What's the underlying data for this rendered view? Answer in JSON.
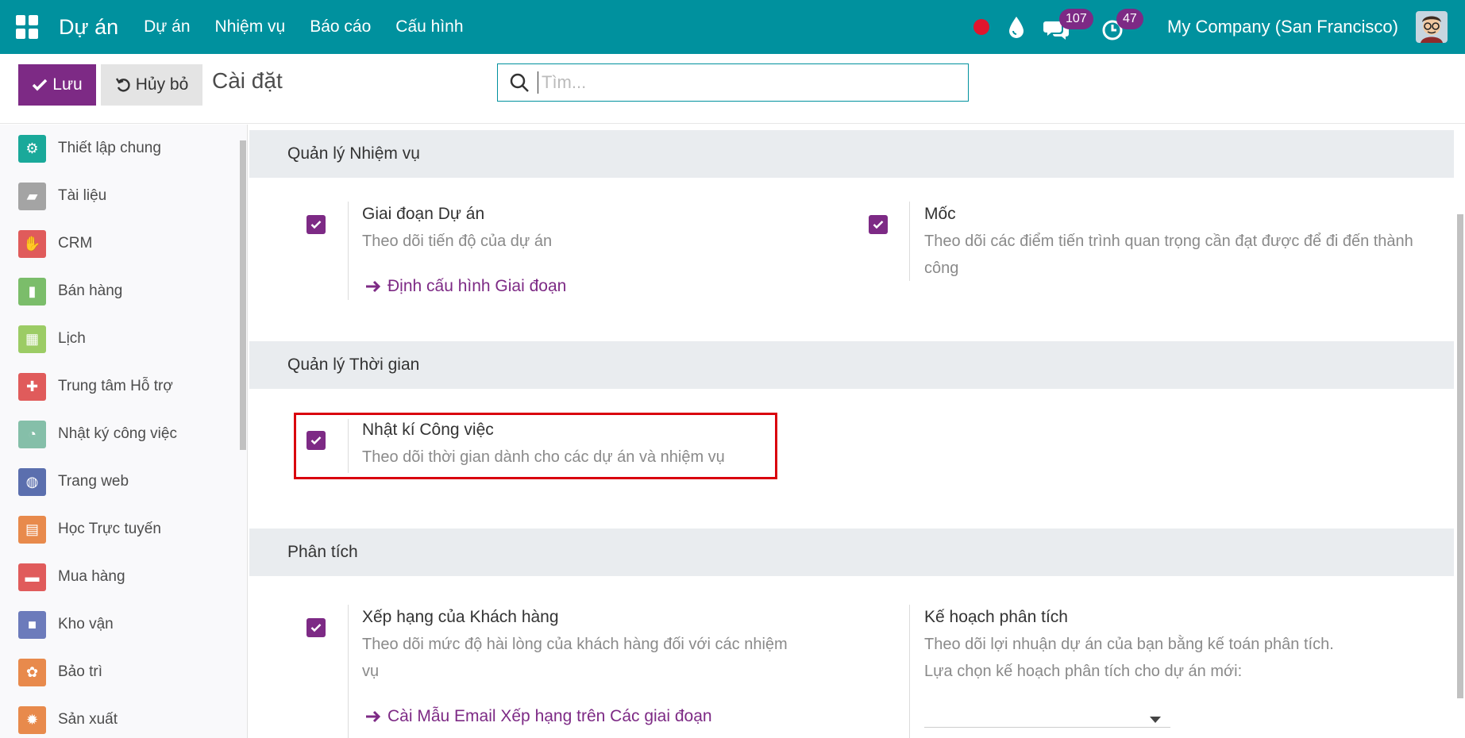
{
  "navbar": {
    "brand": "Dự án",
    "menu": [
      "Dự án",
      "Nhiệm vụ",
      "Báo cáo",
      "Cấu hình"
    ],
    "messages_count": "107",
    "activities_count": "47",
    "company": "My Company (San Francisco)",
    "accent": "#00919e"
  },
  "control": {
    "save_label": "Lưu",
    "discard_label": "Hủy bỏ",
    "title": "Cài đặt",
    "search_placeholder": "Tìm..."
  },
  "sidebar": {
    "items": [
      {
        "label": "Thiết lập chung",
        "icon": "gear-icon",
        "color": "#1aa99a"
      },
      {
        "label": "Tài liệu",
        "icon": "folder-icon",
        "color": "#a4a4a4"
      },
      {
        "label": "CRM",
        "icon": "handshake-icon",
        "color": "#e05b5b"
      },
      {
        "label": "Bán hàng",
        "icon": "chart-icon",
        "color": "#7bbd6a"
      },
      {
        "label": "Lịch",
        "icon": "calendar-icon",
        "color": "#9ccc65"
      },
      {
        "label": "Trung tâm Hỗ trợ",
        "icon": "support-icon",
        "color": "#e05b5b"
      },
      {
        "label": "Nhật ký công việc",
        "icon": "timesheet-icon",
        "color": "#85bfa9"
      },
      {
        "label": "Trang web",
        "icon": "globe-icon",
        "color": "#5b6fae"
      },
      {
        "label": "Học Trực tuyến",
        "icon": "elearning-icon",
        "color": "#e88a4c"
      },
      {
        "label": "Mua hàng",
        "icon": "card-icon",
        "color": "#e05b5b"
      },
      {
        "label": "Kho vận",
        "icon": "box-icon",
        "color": "#6c7bbb"
      },
      {
        "label": "Bảo trì",
        "icon": "maintenance-icon",
        "color": "#e88a4c"
      },
      {
        "label": "Sản xuất",
        "icon": "manufacturing-icon",
        "color": "#e88a4c"
      }
    ]
  },
  "sections": {
    "tasks": {
      "title": "Quản lý Nhiệm vụ",
      "stages": {
        "title": "Giai đoạn Dự án",
        "desc": "Theo dõi tiến độ của dự án",
        "link": "Định cấu hình Giai đoạn"
      },
      "milestones": {
        "title": "Mốc",
        "desc": "Theo dõi các điểm tiến trình quan trọng cần đạt được để đi đến thành công"
      }
    },
    "time": {
      "title": "Quản lý Thời gian",
      "timesheets": {
        "title": "Nhật kí Công việc",
        "desc": "Theo dõi thời gian dành cho các dự án và nhiệm vụ"
      }
    },
    "analytics": {
      "title": "Phân tích",
      "rating": {
        "title": "Xếp hạng của Khách hàng",
        "desc": "Theo dõi mức độ hài lòng của khách hàng đối với các nhiệm vụ",
        "link": "Cài Mẫu Email Xếp hạng trên Các giai đoạn"
      },
      "plan": {
        "title": "Kế hoạch phân tích",
        "desc": "Theo dõi lợi nhuận dự án của bạn bằng kế toán phân tích.",
        "desc2": "Lựa chọn kế hoạch phân tích cho dự án mới:"
      }
    }
  }
}
